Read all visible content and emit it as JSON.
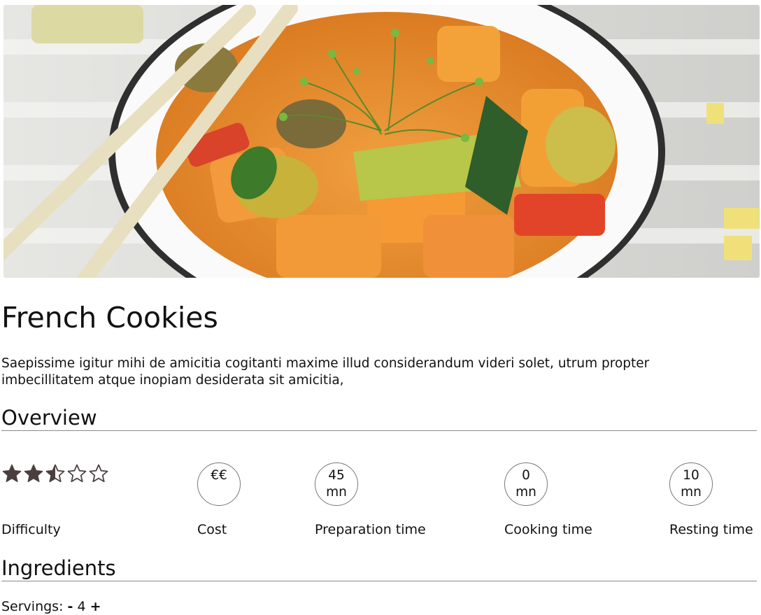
{
  "hero": {
    "alt": "Bowl of roasted vegetables with chopsticks"
  },
  "recipe": {
    "title": "French Cookies",
    "description": "Saepissime igitur mihi de amicitia cogitanti maxime illud considerandum videri solet, utrum propter imbecillitatem atque inopiam desiderata sit amicitia,"
  },
  "overview": {
    "heading": "Overview",
    "difficulty": {
      "label": "Difficulty",
      "rating": 2.5,
      "max": 5
    },
    "cost": {
      "label": "Cost",
      "value": "€€"
    },
    "preparation": {
      "label": "Preparation time",
      "value": "45",
      "unit": "mn"
    },
    "cooking": {
      "label": "Cooking time",
      "value": "0",
      "unit": "mn"
    },
    "resting": {
      "label": "Resting time",
      "value": "10",
      "unit": "mn"
    }
  },
  "ingredients": {
    "heading": "Ingredients",
    "servings_label": "Servings:",
    "servings_value": "4",
    "decrement": "-",
    "increment": "+"
  },
  "colors": {
    "star": "#4a3f3f",
    "rule": "#8a8a8a"
  }
}
